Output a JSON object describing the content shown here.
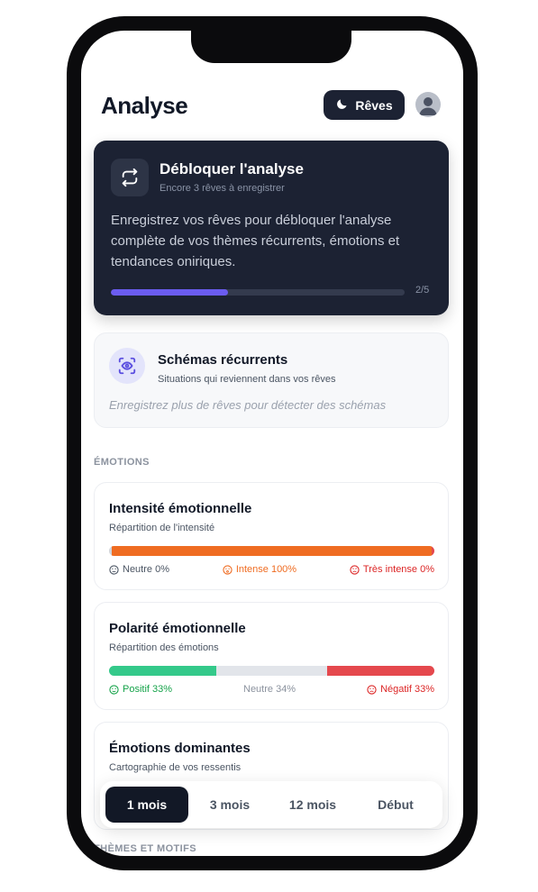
{
  "header": {
    "title": "Analyse",
    "reves_button_label": "Rêves",
    "reves_icon": "moon-icon",
    "avatar_icon": "user-avatar-icon"
  },
  "unlock_card": {
    "icon": "refresh-icon",
    "title": "Débloquer l'analyse",
    "subtitle": "Encore 3 rêves à enregistrer",
    "description": "Enregistrez vos rêves pour débloquer l'analyse complète de vos thèmes récurrents, émotions et tendances oniriques.",
    "progress_label": "2/5",
    "progress_fraction": 0.4,
    "accent_color": "#6b5cf0"
  },
  "patterns_card": {
    "icon": "eye-scan-icon",
    "title": "Schémas récurrents",
    "subtitle": "Situations qui reviennent dans vos rêves",
    "empty_message": "Enregistrez plus de rêves pour détecter des schémas"
  },
  "sections": {
    "emotions_label": "ÉMOTIONS",
    "themes_label": "THÈMES ET MOTIFS"
  },
  "intensity_card": {
    "title": "Intensité émotionnelle",
    "subtitle": "Répartition de l'intensité",
    "segments": [
      {
        "label": "Neutre 0%",
        "value": 0,
        "color": "#d1d5db",
        "icon": "neutral-face-icon",
        "text_color": "#4b5563"
      },
      {
        "label": "Intense 100%",
        "value": 100,
        "color": "#ef6c22",
        "icon": "surprised-face-icon",
        "text_color": "#ef6c22"
      },
      {
        "label": "Très intense 0%",
        "value": 0,
        "color": "#e5484d",
        "icon": "angry-face-icon",
        "text_color": "#dc2626"
      }
    ]
  },
  "polarity_card": {
    "title": "Polarité émotionnelle",
    "subtitle": "Répartition des émotions",
    "segments": [
      {
        "label": "Positif 33%",
        "value": 33,
        "color": "#34c98a",
        "icon": "smile-face-icon",
        "text_color": "#16a34a"
      },
      {
        "label": "Neutre 34%",
        "value": 34,
        "color": "#e2e5ea",
        "icon": "",
        "text_color": "#8b929e"
      },
      {
        "label": "Négatif 33%",
        "value": 33,
        "color": "#e5484d",
        "icon": "sad-face-icon",
        "text_color": "#dc2626"
      }
    ]
  },
  "dominant_card": {
    "title": "Émotions dominantes",
    "subtitle": "Cartographie de vos ressentis"
  },
  "range_selector": {
    "options": [
      "1 mois",
      "3 mois",
      "12 mois",
      "Début"
    ],
    "selected": "1 mois"
  }
}
